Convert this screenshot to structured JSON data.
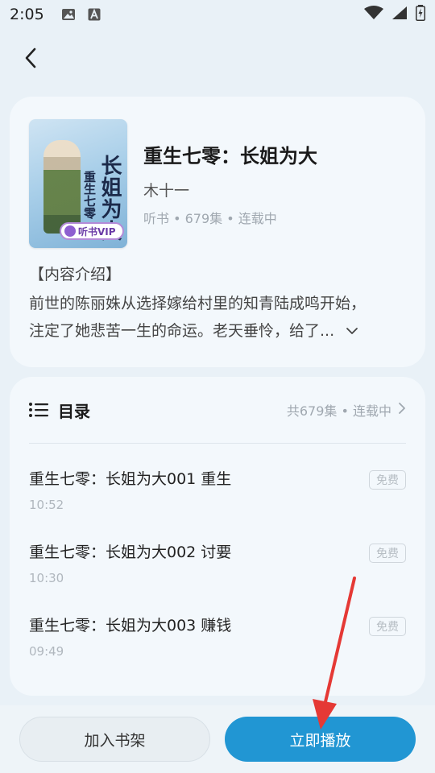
{
  "status_bar": {
    "time": "2:05"
  },
  "book": {
    "title": "重生七零：长姐为大",
    "author": "木十一",
    "meta": "听书 • 679集 • 连载中",
    "cover": {
      "title_main": "长姐为大",
      "title_sub": "重生七零",
      "vip_label": "听书VIP"
    }
  },
  "intro": {
    "heading": "【内容介绍】",
    "line1": "前世的陈丽姝从选择嫁给村里的知青陆成鸣开始，",
    "line2": "注定了她悲苦一生的命运。老天垂怜，给了..."
  },
  "toc": {
    "title": "目录",
    "summary": "共679集 • 连载中",
    "episodes": [
      {
        "title": "重生七零：长姐为大001 重生",
        "duration": "10:52",
        "tag": "免费"
      },
      {
        "title": "重生七零：长姐为大002 讨要",
        "duration": "10:30",
        "tag": "免费"
      },
      {
        "title": "重生七零：长姐为大003 赚钱",
        "duration": "09:49",
        "tag": "免费"
      }
    ]
  },
  "actions": {
    "add_to_shelf": "加入书架",
    "play_now": "立即播放"
  },
  "colors": {
    "accent": "#2196d3",
    "annotation_arrow": "#e53935"
  }
}
